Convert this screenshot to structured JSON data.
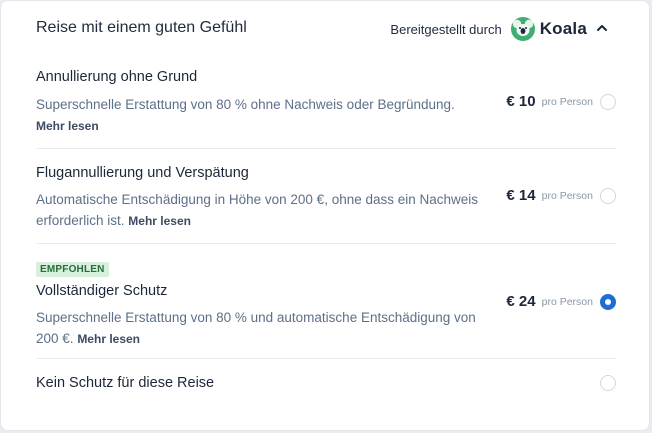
{
  "header": {
    "title": "Reise mit einem guten Gefühl",
    "provided_by": "Bereitgestellt durch",
    "provider_name": "Koala",
    "icons": {
      "logo": "koala-logo-icon",
      "toggle": "chevron-up-icon"
    }
  },
  "options": [
    {
      "title": "Annullierung ohne Grund",
      "description": "Superschnelle Erstattung von 80 % ohne Nachweis oder Begründung.",
      "more": "Mehr lesen",
      "price": "€ 10",
      "unit": "pro Person",
      "selected": false
    },
    {
      "title": "Flugannullierung und Verspätung",
      "description": "Automatische Entschädigung in Höhe von 200 €, ohne dass ein Nachweis erforderlich ist.",
      "more": "Mehr lesen",
      "price": "€ 14",
      "unit": "pro Person",
      "selected": false
    },
    {
      "badge": "EMPFOHLEN",
      "title": "Vollständiger Schutz",
      "description": "Superschnelle Erstattung von 80 % und automatische Entschädigung von 200 €.",
      "more": "Mehr lesen",
      "price": "€ 24",
      "unit": "pro Person",
      "selected": true
    },
    {
      "title": "Kein Schutz für diese Reise",
      "selected": false
    }
  ],
  "colors": {
    "accent": "#1e6dd6",
    "badge_bg": "#d6f0db",
    "badge_text": "#2a6b3c",
    "koala_green": "#3fae73"
  }
}
